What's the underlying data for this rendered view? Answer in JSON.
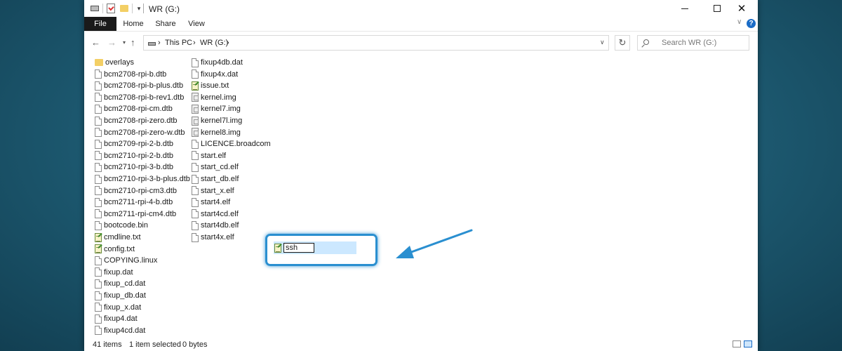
{
  "window": {
    "title": "WR (G:)"
  },
  "ribbon": {
    "tabs": [
      "File",
      "Home",
      "Share",
      "View"
    ]
  },
  "address": {
    "crumbs": [
      "This PC",
      "WR (G:)"
    ]
  },
  "search": {
    "placeholder": "Search WR (G:)"
  },
  "files": {
    "col1": [
      {
        "name": "overlays",
        "icon": "folder-icon"
      },
      {
        "name": "bcm2708-rpi-b.dtb",
        "icon": "file-icon"
      },
      {
        "name": "bcm2708-rpi-b-plus.dtb",
        "icon": "file-icon"
      },
      {
        "name": "bcm2708-rpi-b-rev1.dtb",
        "icon": "file-icon"
      },
      {
        "name": "bcm2708-rpi-cm.dtb",
        "icon": "file-icon"
      },
      {
        "name": "bcm2708-rpi-zero.dtb",
        "icon": "file-icon"
      },
      {
        "name": "bcm2708-rpi-zero-w.dtb",
        "icon": "file-icon"
      },
      {
        "name": "bcm2709-rpi-2-b.dtb",
        "icon": "file-icon"
      },
      {
        "name": "bcm2710-rpi-2-b.dtb",
        "icon": "file-icon"
      },
      {
        "name": "bcm2710-rpi-3-b.dtb",
        "icon": "file-icon"
      },
      {
        "name": "bcm2710-rpi-3-b-plus.dtb",
        "icon": "file-icon"
      },
      {
        "name": "bcm2710-rpi-cm3.dtb",
        "icon": "file-icon"
      },
      {
        "name": "bcm2711-rpi-4-b.dtb",
        "icon": "file-icon"
      },
      {
        "name": "bcm2711-rpi-cm4.dtb",
        "icon": "file-icon"
      },
      {
        "name": "bootcode.bin",
        "icon": "file-icon"
      },
      {
        "name": "cmdline.txt",
        "icon": "text-file-icon"
      },
      {
        "name": "config.txt",
        "icon": "text-file-icon"
      },
      {
        "name": "COPYING.linux",
        "icon": "file-icon"
      },
      {
        "name": "fixup.dat",
        "icon": "file-icon"
      },
      {
        "name": "fixup_cd.dat",
        "icon": "file-icon"
      },
      {
        "name": "fixup_db.dat",
        "icon": "file-icon"
      },
      {
        "name": "fixup_x.dat",
        "icon": "file-icon"
      },
      {
        "name": "fixup4.dat",
        "icon": "file-icon"
      },
      {
        "name": "fixup4cd.dat",
        "icon": "file-icon"
      }
    ],
    "col2": [
      {
        "name": "fixup4db.dat",
        "icon": "file-icon"
      },
      {
        "name": "fixup4x.dat",
        "icon": "file-icon"
      },
      {
        "name": "issue.txt",
        "icon": "text-file-icon"
      },
      {
        "name": "kernel.img",
        "icon": "image-file-icon"
      },
      {
        "name": "kernel7.img",
        "icon": "image-file-icon"
      },
      {
        "name": "kernel7l.img",
        "icon": "image-file-icon"
      },
      {
        "name": "kernel8.img",
        "icon": "image-file-icon"
      },
      {
        "name": "LICENCE.broadcom",
        "icon": "file-icon"
      },
      {
        "name": "start.elf",
        "icon": "file-icon"
      },
      {
        "name": "start_cd.elf",
        "icon": "file-icon"
      },
      {
        "name": "start_db.elf",
        "icon": "file-icon"
      },
      {
        "name": "start_x.elf",
        "icon": "file-icon"
      },
      {
        "name": "start4.elf",
        "icon": "file-icon"
      },
      {
        "name": "start4cd.elf",
        "icon": "file-icon"
      },
      {
        "name": "start4db.elf",
        "icon": "file-icon"
      },
      {
        "name": "start4x.elf",
        "icon": "file-icon"
      }
    ],
    "renaming": {
      "value": "ssh",
      "icon": "text-file-icon"
    }
  },
  "status": {
    "count": "41 items",
    "selected": "1 item selected",
    "size": "0 bytes"
  },
  "colors": {
    "accent": "#2a8fd0",
    "file_tab": "#1a1a1a",
    "selection": "#cce8ff"
  }
}
